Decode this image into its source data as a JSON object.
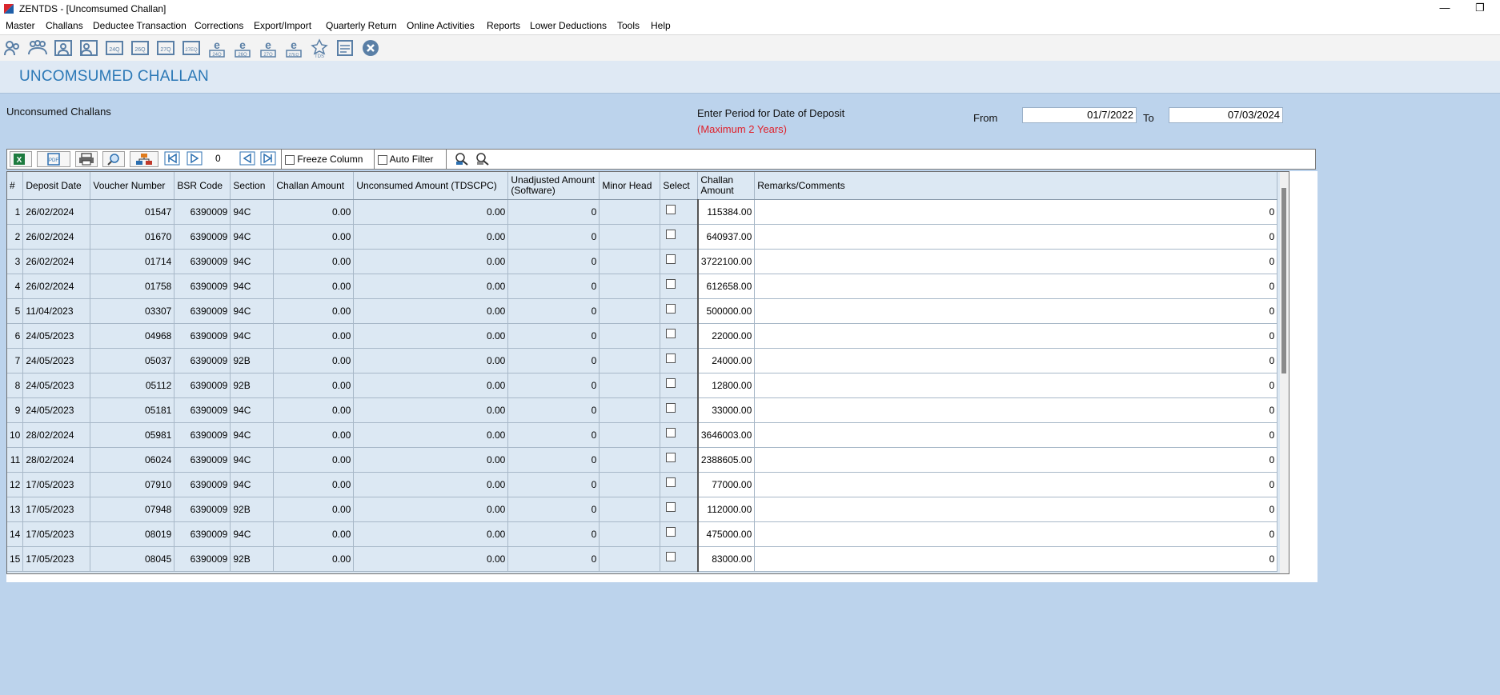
{
  "window": {
    "title": "ZENTDS - [Uncomsumed Challan]",
    "minimize_glyph": "—",
    "restore_glyph": "❐"
  },
  "menu": [
    "Master",
    "Challans",
    "Deductee Transaction",
    "Corrections",
    "Export/Import",
    "Quarterly Return",
    "Online Activities",
    "Reports",
    "Lower Deductions",
    "Tools",
    "Help"
  ],
  "toolbar_icons": [
    {
      "name": "deductor-icon",
      "label": ""
    },
    {
      "name": "deductees-icon",
      "label": ""
    },
    {
      "name": "employee-icon",
      "label": ""
    },
    {
      "name": "employee-detail-icon",
      "label": ""
    },
    {
      "name": "form-24q-icon",
      "label": "24Q"
    },
    {
      "name": "form-26q-icon",
      "label": "26Q"
    },
    {
      "name": "form-27q-icon",
      "label": "27Q"
    },
    {
      "name": "form-27eq-icon",
      "label": "27EQ"
    },
    {
      "name": "e-24q-icon",
      "label": "24Q"
    },
    {
      "name": "e-26q-icon",
      "label": "26Q"
    },
    {
      "name": "e-27q-icon",
      "label": "27Q"
    },
    {
      "name": "e-27eq-icon",
      "label": "27EQ"
    },
    {
      "name": "tds-icon",
      "label": "TDS"
    },
    {
      "name": "notes-icon",
      "label": ""
    },
    {
      "name": "close-circle-icon",
      "label": ""
    }
  ],
  "page": {
    "title": "UNCOMSUMED CHALLAN",
    "section_label": "Unconsumed Challans",
    "period_label": "Enter Period for Date of Deposit",
    "period_note": "(Maximum 2 Years)",
    "from_label": "From",
    "to_label": "To",
    "from_date": "01/7/2022",
    "to_date": "07/03/2024"
  },
  "gridbar": {
    "record_number": "0",
    "freeze_label": "Freeze Column",
    "autofilter_label": "Auto Filter",
    "freeze_checked": false,
    "autofilter_checked": false
  },
  "colors": {
    "background": "#bcd3ec",
    "title": "#2b78b6",
    "note_red": "#e0202a",
    "grid_cell": "#dce8f3"
  },
  "table": {
    "headers": [
      "#",
      "Deposit Date",
      "Voucher Number",
      "BSR Code",
      "Section",
      "Challan Amount",
      "Unconsumed Amount (TDSCPC)",
      "Unadjusted Amount (Software)",
      "Minor Head",
      "Select",
      "Challan Amount",
      "Remarks/Comments"
    ],
    "rows": [
      {
        "n": "1",
        "date": "26/02/2024",
        "voucher": "01547",
        "bsr": "6390009",
        "section": "94C",
        "challan": "0.00",
        "unconsumed": "0.00",
        "unadjusted": "0",
        "minor": "",
        "select": false,
        "challan2": "115384.00",
        "remarks": "0"
      },
      {
        "n": "2",
        "date": "26/02/2024",
        "voucher": "01670",
        "bsr": "6390009",
        "section": "94C",
        "challan": "0.00",
        "unconsumed": "0.00",
        "unadjusted": "0",
        "minor": "",
        "select": false,
        "challan2": "640937.00",
        "remarks": "0"
      },
      {
        "n": "3",
        "date": "26/02/2024",
        "voucher": "01714",
        "bsr": "6390009",
        "section": "94C",
        "challan": "0.00",
        "unconsumed": "0.00",
        "unadjusted": "0",
        "minor": "",
        "select": false,
        "challan2": "3722100.00",
        "remarks": "0"
      },
      {
        "n": "4",
        "date": "26/02/2024",
        "voucher": "01758",
        "bsr": "6390009",
        "section": "94C",
        "challan": "0.00",
        "unconsumed": "0.00",
        "unadjusted": "0",
        "minor": "",
        "select": false,
        "challan2": "612658.00",
        "remarks": "0"
      },
      {
        "n": "5",
        "date": "11/04/2023",
        "voucher": "03307",
        "bsr": "6390009",
        "section": "94C",
        "challan": "0.00",
        "unconsumed": "0.00",
        "unadjusted": "0",
        "minor": "",
        "select": false,
        "challan2": "500000.00",
        "remarks": "0"
      },
      {
        "n": "6",
        "date": "24/05/2023",
        "voucher": "04968",
        "bsr": "6390009",
        "section": "94C",
        "challan": "0.00",
        "unconsumed": "0.00",
        "unadjusted": "0",
        "minor": "",
        "select": false,
        "challan2": "22000.00",
        "remarks": "0"
      },
      {
        "n": "7",
        "date": "24/05/2023",
        "voucher": "05037",
        "bsr": "6390009",
        "section": "92B",
        "challan": "0.00",
        "unconsumed": "0.00",
        "unadjusted": "0",
        "minor": "",
        "select": false,
        "challan2": "24000.00",
        "remarks": "0"
      },
      {
        "n": "8",
        "date": "24/05/2023",
        "voucher": "05112",
        "bsr": "6390009",
        "section": "92B",
        "challan": "0.00",
        "unconsumed": "0.00",
        "unadjusted": "0",
        "minor": "",
        "select": false,
        "challan2": "12800.00",
        "remarks": "0"
      },
      {
        "n": "9",
        "date": "24/05/2023",
        "voucher": "05181",
        "bsr": "6390009",
        "section": "94C",
        "challan": "0.00",
        "unconsumed": "0.00",
        "unadjusted": "0",
        "minor": "",
        "select": false,
        "challan2": "33000.00",
        "remarks": "0"
      },
      {
        "n": "10",
        "date": "28/02/2024",
        "voucher": "05981",
        "bsr": "6390009",
        "section": "94C",
        "challan": "0.00",
        "unconsumed": "0.00",
        "unadjusted": "0",
        "minor": "",
        "select": false,
        "challan2": "3646003.00",
        "remarks": "0"
      },
      {
        "n": "11",
        "date": "28/02/2024",
        "voucher": "06024",
        "bsr": "6390009",
        "section": "94C",
        "challan": "0.00",
        "unconsumed": "0.00",
        "unadjusted": "0",
        "minor": "",
        "select": false,
        "challan2": "2388605.00",
        "remarks": "0"
      },
      {
        "n": "12",
        "date": "17/05/2023",
        "voucher": "07910",
        "bsr": "6390009",
        "section": "94C",
        "challan": "0.00",
        "unconsumed": "0.00",
        "unadjusted": "0",
        "minor": "",
        "select": false,
        "challan2": "77000.00",
        "remarks": "0"
      },
      {
        "n": "13",
        "date": "17/05/2023",
        "voucher": "07948",
        "bsr": "6390009",
        "section": "92B",
        "challan": "0.00",
        "unconsumed": "0.00",
        "unadjusted": "0",
        "minor": "",
        "select": false,
        "challan2": "112000.00",
        "remarks": "0"
      },
      {
        "n": "14",
        "date": "17/05/2023",
        "voucher": "08019",
        "bsr": "6390009",
        "section": "94C",
        "challan": "0.00",
        "unconsumed": "0.00",
        "unadjusted": "0",
        "minor": "",
        "select": false,
        "challan2": "475000.00",
        "remarks": "0"
      },
      {
        "n": "15",
        "date": "17/05/2023",
        "voucher": "08045",
        "bsr": "6390009",
        "section": "92B",
        "challan": "0.00",
        "unconsumed": "0.00",
        "unadjusted": "0",
        "minor": "",
        "select": false,
        "challan2": "83000.00",
        "remarks": "0"
      }
    ]
  }
}
